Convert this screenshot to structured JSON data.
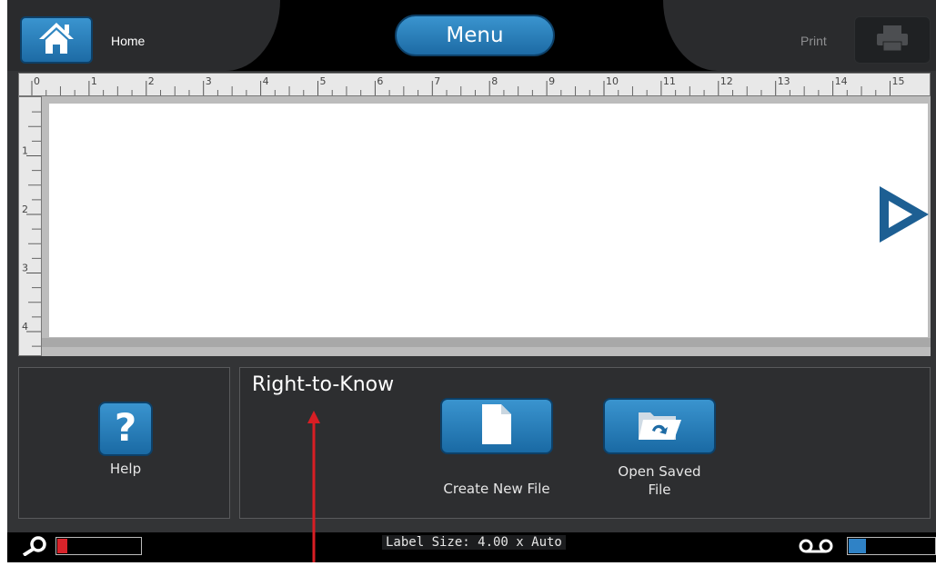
{
  "header": {
    "home_label": "Home",
    "menu_label": "Menu",
    "print_label": "Print"
  },
  "ruler": {
    "horizontal_ticks": [
      "0",
      "1",
      "2",
      "3",
      "4",
      "5",
      "6",
      "7",
      "8",
      "9",
      "10",
      "11",
      "12",
      "13",
      "14",
      "15"
    ],
    "vertical_ticks": [
      "1",
      "2",
      "3",
      "4"
    ]
  },
  "panels": {
    "help_label": "Help",
    "file_title": "Right-to-Know",
    "create_label": "Create New File",
    "open_label_line1": "Open Saved",
    "open_label_line2": "File"
  },
  "status": {
    "label_size": "Label Size: 4.00 x Auto",
    "zoom_level_fraction": 0.12,
    "supply_level_fraction": 0.2
  },
  "colors": {
    "accent_blue": "#2a7fbf",
    "zoom_red": "#d8232a",
    "annotation_red": "#d81e24"
  },
  "icons": [
    "home-icon",
    "printer-icon",
    "scroll-right-icon",
    "question-mark-icon",
    "new-file-icon",
    "open-folder-icon",
    "zoom-icon",
    "tape-supply-icon"
  ]
}
